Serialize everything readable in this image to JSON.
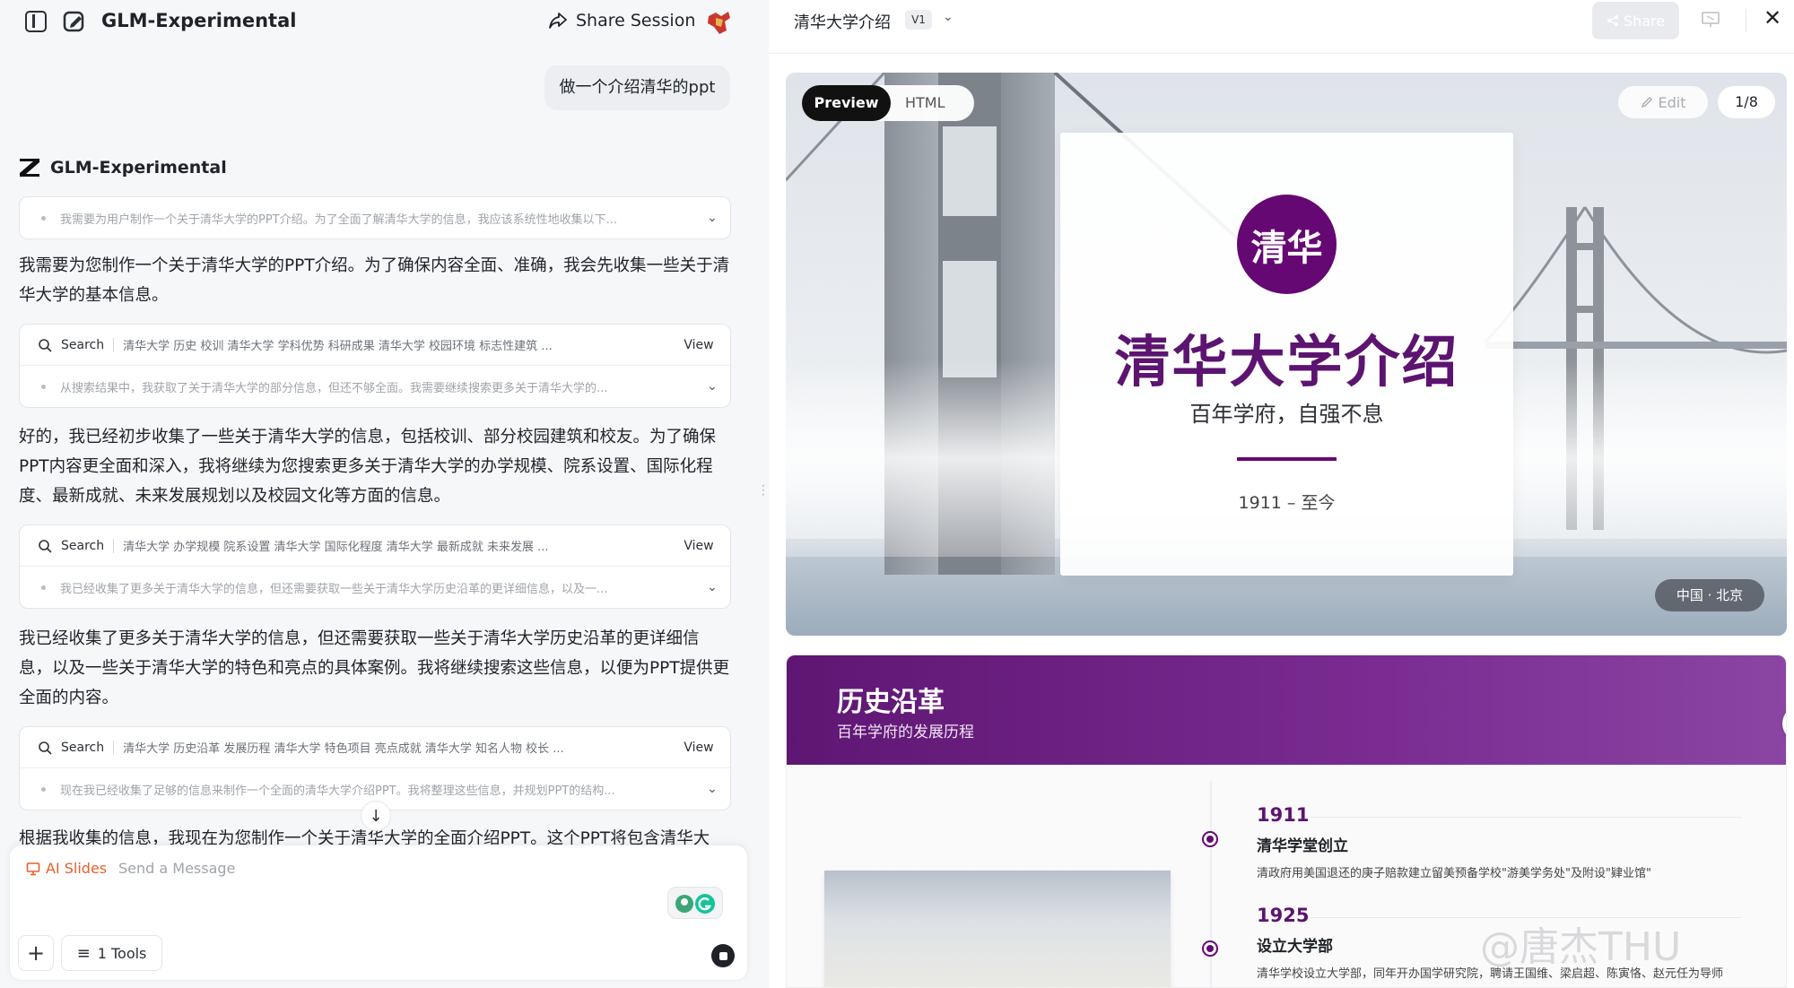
{
  "left": {
    "app_title": "GLM-Experimental",
    "share_session": "Share Session",
    "user_message": "做一个介绍清华的ppt",
    "assistant_name": "GLM-Experimental",
    "thinking_1": "我需要为用户制作一个关于清华大学的PPT介绍。为了全面了解清华大学的信息，我应该系统性地收集以下...",
    "para_1": "我需要为您制作一个关于清华大学的PPT介绍。为了确保内容全面、准确，我会先收集一些关于清华大学的基本信息。",
    "search_1": {
      "label": "Search",
      "queries": "清华大学 历史 校训    清华大学 学科优势 科研成果    清华大学 校园环境 标志性建筑 ...",
      "view": "View",
      "thinking": "从搜索结果中，我获取了关于清华大学的部分信息，但还不够全面。我需要继续搜索更多关于清华大学的..."
    },
    "para_2": "好的，我已经初步收集了一些关于清华大学的信息，包括校训、部分校园建筑和校友。为了确保PPT内容更全面和深入，我将继续为您搜索更多关于清华大学的办学规模、院系设置、国际化程度、最新成就、未来发展规划以及校园文化等方面的信息。",
    "search_2": {
      "label": "Search",
      "queries": "清华大学 办学规模 院系设置    清华大学 国际化程度    清华大学 最新成就 未来发展 ...",
      "view": "View",
      "thinking": "我已经收集了更多关于清华大学的信息，但还需要获取一些关于清华大学历史沿革的更详细信息，以及一..."
    },
    "para_3": "我已经收集了更多关于清华大学的信息，但还需要获取一些关于清华大学历史沿革的更详细信息，以及一些关于清华大学的特色和亮点的具体案例。我将继续搜索这些信息，以便为PPT提供更全面的内容。",
    "search_3": {
      "label": "Search",
      "queries": "清华大学 历史沿革 发展历程    清华大学 特色项目 亮点成就    清华大学 知名人物 校长 ...",
      "view": "View",
      "thinking": "现在我已经收集了足够的信息来制作一个全面的清华大学介绍PPT。我将整理这些信息，并规划PPT的结构..."
    },
    "para_4": "根据我收集的信息，我现在为您制作一个关于清华大学的全面介绍PPT。这个PPT将包含清华大",
    "composer": {
      "mode": "AI Slides",
      "placeholder": "Send a Message",
      "tools": "1 Tools"
    }
  },
  "right": {
    "doc_title": "清华大学介绍",
    "version": "V1",
    "share": "Share",
    "tabs": {
      "preview": "Preview",
      "html": "HTML"
    },
    "edit": "Edit",
    "page": "1/8",
    "slide1": {
      "seal": "清华",
      "title": "清华大学介绍",
      "subtitle": "百年学府，自强不息",
      "years": "1911 – 至今",
      "location": "中国 · 北京"
    },
    "slide2": {
      "title": "历史沿革",
      "subtitle": "百年学府的发展历程",
      "events": [
        {
          "year": "1911",
          "title": "清华学堂创立",
          "desc": "清政府用美国退还的庚子赔款建立留美预备学校\"游美学务处\"及附设\"肄业馆\""
        },
        {
          "year": "1925",
          "title": "设立大学部",
          "desc": "清华学校设立大学部，同年开办国学研究院，聘请王国维、梁启超、陈寅恪、赵元任为导师"
        }
      ]
    },
    "watermark": "@唐杰THU"
  },
  "colors": {
    "accent_purple": "#660874",
    "ai_slides_orange": "#e8602c"
  }
}
